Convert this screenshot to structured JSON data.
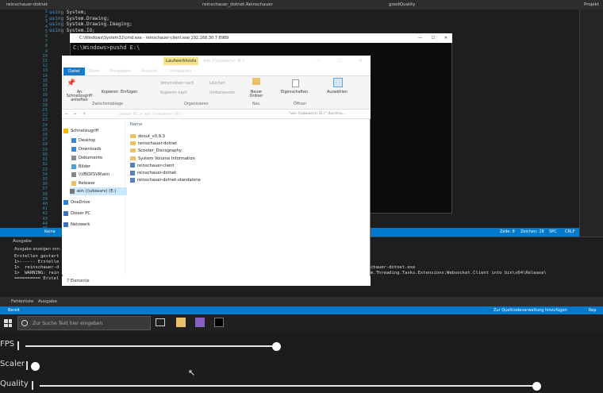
{
  "vs": {
    "tabs": [
      "reinschauer-dotnet",
      "reinschauer_dotnet.Reinschauer",
      "goodQuality"
    ],
    "right_tab": "Projekt",
    "code_lines": [
      {
        "kw": "using",
        "rest": " System;"
      },
      {
        "kw": "using",
        "rest": " System.Drawing;"
      },
      {
        "kw": "using",
        "rest": " System.Drawing.Imaging;"
      },
      {
        "kw": "using",
        "rest": " System.IO;"
      }
    ],
    "line_numbers": [
      "1",
      "2",
      "3",
      "4",
      "5",
      "6",
      "7",
      "8",
      "9",
      "10",
      "11",
      "12",
      "13",
      "14",
      "15",
      "16",
      "17",
      "18",
      "19",
      "20",
      "21",
      "22",
      "23",
      "24",
      "25",
      "26",
      "27",
      "28",
      "29",
      "30",
      "31",
      "32",
      "33",
      "34",
      "35",
      "36",
      "37",
      "38",
      "39",
      "40",
      "41",
      "42",
      "43",
      "44",
      "45"
    ],
    "status": {
      "issues": "Keine",
      "zeile": "Zeile: 8",
      "zeichen": "Zeichen: 28",
      "spc": "SPC",
      "crlf": "CRLF"
    },
    "output": {
      "title": "Ausgabe",
      "source_label": "Ausgabe anzeigen von:",
      "lines": [
        "Erstellen gestart",
        "1>------ Erstelle",
        "1>  reinschauer-d",
        "1>  WARNING: rein",
        "========== Erstel"
      ],
      "right_lines": [
        "chauer-dotnet.exe",
        "m.Threading.Tasks.Extensions;Websocket.Client into bin\\x64\\Release\\"
      ]
    },
    "bottom_tabs": [
      "Fehlerliste",
      "Ausgabe"
    ],
    "bottom_status": {
      "left": "Bereit",
      "middle": "Zur Quellcodeverwaltung hinzufügen",
      "right": "Rep"
    }
  },
  "console": {
    "title": "C:\\Windows\\System32\\cmd.exe - reinschauer-client.exe 192.168.30.7 8989",
    "text": "C:\\Windows>pushd E:\\"
  },
  "explorer": {
    "context_tab": "Laufwerktools",
    "title": "win (\\\\vboxsrv) (E:)",
    "tabs": [
      "Datei",
      "Start",
      "Freigeben",
      "Ansicht",
      "Verwalten"
    ],
    "ribbon": {
      "pin": "An Schnellzugriff anheften",
      "copy": "Kopieren",
      "paste": "Einfügen",
      "clipboard_group": "Zwischenablage",
      "move": "Verschieben nach",
      "copy_to": "Kopieren nach",
      "delete": "Löschen",
      "rename": "Umbenennen",
      "new_folder": "Neuer Ordner",
      "organize_group": "Organisieren",
      "new_group": "Neu",
      "properties": "Eigenschaften",
      "open_group": "Öffnen",
      "select": "Auswählen"
    },
    "address": {
      "crumbs": "Dieser PC  >  win (\\\\vboxsrv) (E:)",
      "search": "\"win (\\\\vboxsrv) (E:)\" durchsu..."
    },
    "nav": [
      {
        "label": "Schnellzugriff",
        "icon": "star-icon"
      },
      {
        "label": "Desktop",
        "icon": "desktop-icon"
      },
      {
        "label": "Downloads",
        "icon": "download-icon"
      },
      {
        "label": "Dokumente",
        "icon": "document-icon"
      },
      {
        "label": "Bilder",
        "icon": "picture-icon"
      },
      {
        "label": "\\\\VBOXSVR\\win",
        "icon": "network-drive-icon"
      },
      {
        "label": "Release",
        "icon": "folder-icon"
      },
      {
        "label": "win (\\\\vboxsrv) (E:)",
        "icon": "drive-icon"
      },
      {
        "label": "OneDrive",
        "icon": "cloud-icon"
      },
      {
        "label": "Dieser PC",
        "icon": "computer-icon"
      },
      {
        "label": "Netzwerk",
        "icon": "network-icon"
      }
    ],
    "column_header": "Name",
    "files": [
      {
        "name": "donut_v0.9.3",
        "type": "folder"
      },
      {
        "name": "reinschauer-dotnet",
        "type": "folder"
      },
      {
        "name": "Scooter_Discography",
        "type": "folder"
      },
      {
        "name": "System Volume Information",
        "type": "folder"
      },
      {
        "name": "reinschauer-client",
        "type": "file"
      },
      {
        "name": "reinschauer-dotnet",
        "type": "file"
      },
      {
        "name": "reinschauer-dotnet-standalone",
        "type": "file"
      }
    ],
    "status": "7 Elemente"
  },
  "taskbar": {
    "search_placeholder": "Zur Suche Text hier eingeben"
  },
  "sliders": [
    {
      "label": "FPS",
      "value": 0.49
    },
    {
      "label": "Scaler",
      "value": 0.0
    },
    {
      "label": "Quality",
      "value": 1.0
    }
  ]
}
